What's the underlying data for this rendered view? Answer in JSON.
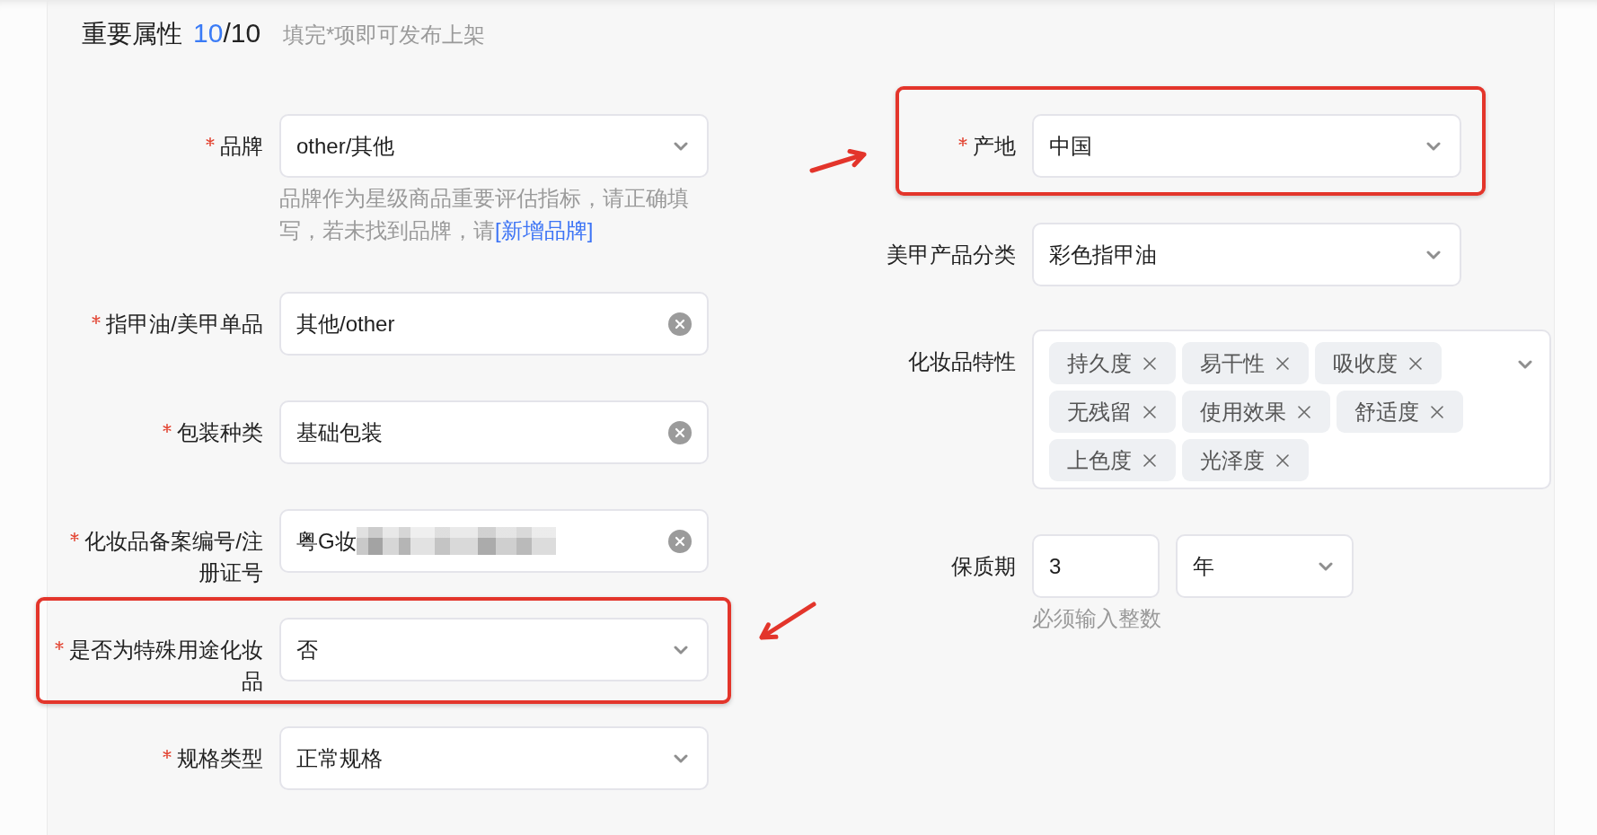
{
  "section": {
    "title": "重要属性",
    "count_done": "10",
    "count_all": "/10",
    "hint": "填完*项即可发布上架"
  },
  "columns": [
    {
      "fields": [
        {
          "label": "品牌",
          "required": true,
          "kind": "select",
          "value": "other/其他",
          "help": "品牌作为星级商品重要评估指标，请正确填写，若未找到品牌，请",
          "help_link": "[新增品牌]"
        },
        {
          "label": "指甲油/美甲单品",
          "required": true,
          "kind": "clearable",
          "value": "其他/other"
        },
        {
          "label": "包装种类",
          "required": true,
          "kind": "clearable",
          "value": "基础包装"
        },
        {
          "label": "化妆品备案编号/注册证号",
          "required": true,
          "kind": "clearable",
          "value": "粤G妆",
          "redacted": true
        },
        {
          "label": "是否为特殊用途化妆品",
          "required": true,
          "kind": "select",
          "value": "否",
          "annotation": {
            "kind": "arrow-right"
          }
        },
        {
          "label": "规格类型",
          "required": true,
          "kind": "select",
          "value": "正常规格"
        }
      ]
    },
    {
      "fields": [
        {
          "label": "产地",
          "required": true,
          "kind": "select",
          "value": "中国",
          "annotation": {
            "kind": "arrow-left"
          }
        },
        {
          "label": "美甲产品分类",
          "required": false,
          "kind": "select",
          "value": "彩色指甲油"
        },
        {
          "label": "化妆品特性",
          "required": false,
          "kind": "tags",
          "tags": [
            "持久度",
            "易干性",
            "吸收度",
            "无残留",
            "使用效果",
            "舒适度",
            "上色度",
            "光泽度"
          ]
        },
        {
          "label": "保质期",
          "required": false,
          "kind": "duration",
          "value": "3",
          "unit": "年",
          "help": "必须输入整数"
        }
      ]
    }
  ]
}
